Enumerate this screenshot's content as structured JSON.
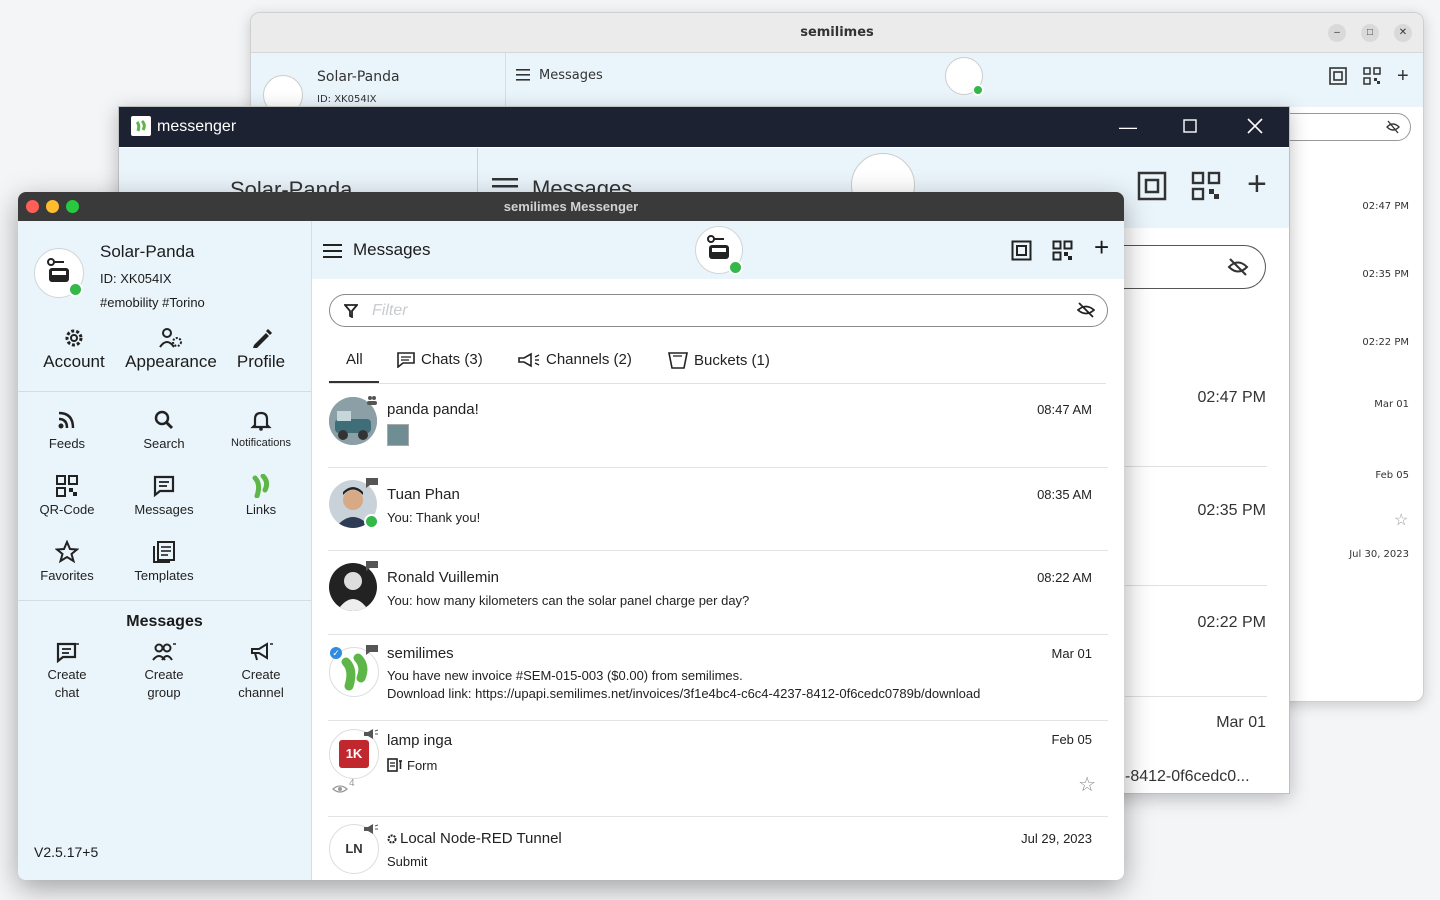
{
  "back_window": {
    "title": "semilimes",
    "profile": {
      "name": "Solar-Panda",
      "id": "ID: XK054IX"
    },
    "header": {
      "title": "Messages"
    },
    "times": [
      "02:47 PM",
      "02:35 PM",
      "02:22 PM",
      "Mar 01",
      "Feb 05",
      "Jul 30, 2023"
    ]
  },
  "middle_window": {
    "title": "messenger",
    "profile": {
      "name": "Solar-Panda"
    },
    "header": {
      "title": "Messages"
    },
    "times": [
      "02:47 PM",
      "02:35 PM",
      "02:22 PM",
      "Mar 01"
    ],
    "preview_text": "-8412-0f6cedc0..."
  },
  "front_window": {
    "title": "semilimes Messenger",
    "profile": {
      "name": "Solar-Panda",
      "id": "ID: XK054IX",
      "tags": "#emobility #Torino"
    },
    "top_actions": [
      {
        "label": "Account",
        "icon": "gear-icon"
      },
      {
        "label": "Appearance",
        "icon": "people-settings-icon"
      },
      {
        "label": "Profile",
        "icon": "pencil-icon"
      }
    ],
    "grid": [
      {
        "label": "Feeds",
        "icon": "rss-icon"
      },
      {
        "label": "Search",
        "icon": "search-icon"
      },
      {
        "label": "Notifications",
        "icon": "bell-icon"
      },
      {
        "label": "QR-Code",
        "icon": "qr-icon"
      },
      {
        "label": "Messages",
        "icon": "chat-icon"
      },
      {
        "label": "Links",
        "icon": "leaf-icon"
      },
      {
        "label": "Favorites",
        "icon": "star-icon"
      },
      {
        "label": "Templates",
        "icon": "templates-icon"
      }
    ],
    "messages_section": {
      "title": "Messages",
      "actions": [
        {
          "line1": "Create",
          "line2": "chat",
          "icon": "create-chat-icon"
        },
        {
          "line1": "Create",
          "line2": "group",
          "icon": "create-group-icon"
        },
        {
          "line1": "Create",
          "line2": "channel",
          "icon": "create-channel-icon"
        }
      ]
    },
    "version": "V2.5.17+5",
    "header": {
      "title": "Messages"
    },
    "filter": {
      "placeholder": "Filter"
    },
    "tabs": [
      {
        "label": "All"
      },
      {
        "label": "Chats (3)"
      },
      {
        "label": "Channels (2)"
      },
      {
        "label": "Buckets (1)"
      }
    ],
    "conversations": [
      {
        "name": "panda panda!",
        "preview": "",
        "time": "08:47 AM"
      },
      {
        "name": "Tuan Phan",
        "preview": "You: Thank you!",
        "time": "08:35 AM"
      },
      {
        "name": "Ronald Vuillemin",
        "preview": "You: how many kilometers can the solar panel charge per day?",
        "time": "08:22 AM"
      },
      {
        "name": "semilimes",
        "preview": "You have new invoice #SEM-015-003 ($0.00) from semilimes.",
        "preview2": "Download link: https://upapi.semilimes.net/invoices/3f1e4bc4-c6c4-4237-8412-0f6cedc0789b/download",
        "time": "Mar 01"
      },
      {
        "name": "lamp inga",
        "preview": "Form",
        "time": "Feb 05",
        "avatar_text": "1K",
        "views": "4"
      },
      {
        "name": "Local Node-RED Tunnel",
        "preview": "Submit",
        "time": "Jul 29, 2023",
        "avatar_text": "LN"
      }
    ],
    "colors": {
      "accent_bg": "#eaf5fb",
      "online": "#34b84a",
      "brand_green": "#5fb648"
    }
  }
}
